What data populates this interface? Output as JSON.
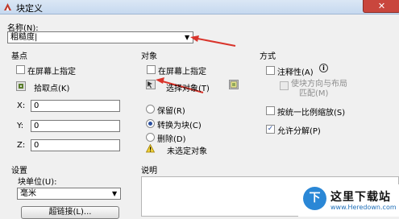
{
  "window": {
    "title": "块定义",
    "close_symbol": "✕",
    "app_icon": "autocad-logo-icon"
  },
  "name_field": {
    "label": "名称(N):",
    "value": "粗糙度|"
  },
  "base_point": {
    "group": "基点",
    "specify_on_screen": "在屏幕上指定",
    "pick_point": "拾取点(K)",
    "x_label": "X:",
    "x_value": "0",
    "y_label": "Y:",
    "y_value": "0",
    "z_label": "Z:",
    "z_value": "0"
  },
  "objects": {
    "group": "对象",
    "specify_on_screen": "在屏幕上指定",
    "select_objects": "选择对象(T)",
    "retain": "保留(R)",
    "convert_to_block": "转换为块(C)",
    "delete": "删除(D)",
    "status": "未选定对象"
  },
  "behavior": {
    "group": "方式",
    "annotative": "注释性(A)",
    "info_symbol": "i",
    "match_orientation_line1": "使块方向与布局",
    "match_orientation_line2": "匹配(M)",
    "scale_uniformly": "按统一比例缩放(S)",
    "allow_exploding": "允许分解(P)",
    "check_mark": "✓"
  },
  "settings": {
    "group": "设置",
    "block_unit_label": "块单位(U):",
    "block_unit_value": "毫米",
    "hyperlink_button": "超链接(L)..."
  },
  "description": {
    "label": "说明"
  },
  "watermark": {
    "logo": "下",
    "text": "这里下载站",
    "url": "www.Heredown.com"
  },
  "colors": {
    "annotation_arrow": "#d9342b",
    "title_bar": "#c6d9ef",
    "close_button": "#c9463d"
  }
}
